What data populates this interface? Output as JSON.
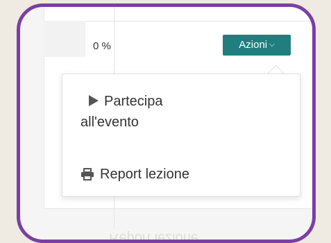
{
  "progress": {
    "value": "0 %"
  },
  "actions": {
    "label": "Azioni",
    "chevron_icon": "chevron-down-icon"
  },
  "menu": {
    "items": [
      {
        "icon": "play-icon",
        "line1": "Partecipa",
        "line2": "all'evento"
      },
      {
        "icon": "print-icon",
        "label": "Report lezione"
      }
    ]
  },
  "ghost": {
    "label": "Report lezione"
  },
  "colors": {
    "frame": "#7b3fa3",
    "button": "#1f7f7f",
    "background": "#efeae2"
  }
}
